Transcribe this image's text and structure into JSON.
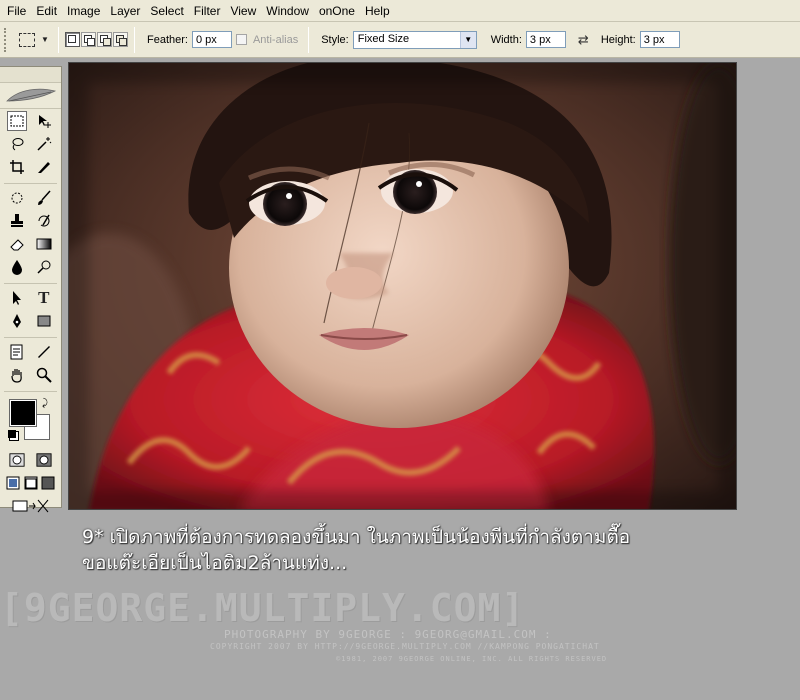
{
  "menu": [
    "File",
    "Edit",
    "Image",
    "Layer",
    "Select",
    "Filter",
    "View",
    "Window",
    "onOne",
    "Help"
  ],
  "options": {
    "feather_label": "Feather:",
    "feather_value": "0 px",
    "antialias_label": "Anti-alias",
    "style_label": "Style:",
    "style_value": "Fixed Size",
    "width_label": "Width:",
    "width_value": "3 px",
    "height_label": "Height:",
    "height_value": "3 px"
  },
  "caption": {
    "line1": "9* เปิดภาพที่ต้องการทดลองขึ้นมา ในภาพเป็นน้องพีนที่กำลังตามตื๊อ",
    "line2": "ขอแต๊ะเอียเป็นไอติม2ล้านแท่ง..."
  },
  "watermark": {
    "main": "[9GEORGE.MULTIPLY.COM]",
    "line1": "PHOTOGRAPHY BY 9GEORGE : 9GEORG@GMAIL.COM :",
    "line2": "COPYRIGHT 2007 BY  HTTP://9GEORGE.MULTIPLY.COM //KAMPONG PONGATICHAT",
    "line3": "©1981, 2007 9GEORGE ONLINE, INC. ALL RIGHTS RESERVED"
  },
  "colors": {
    "foreground": "#000000",
    "background": "#ffffff",
    "ui_chrome": "#ece9d8",
    "workspace": "#a9a9a9"
  }
}
